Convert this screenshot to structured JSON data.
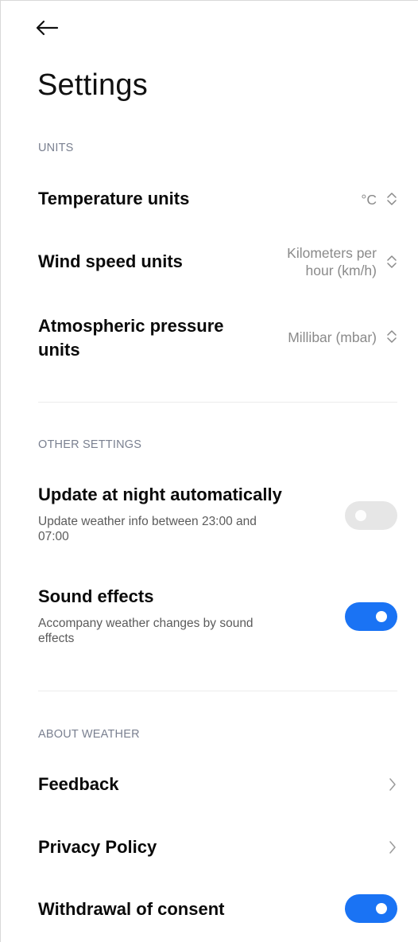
{
  "title": "Settings",
  "sections": {
    "units": {
      "header": "UNITS",
      "temperature": {
        "label": "Temperature units",
        "value": "°C"
      },
      "wind": {
        "label": "Wind speed units",
        "value_line1": "Kilometers per",
        "value_line2": "hour (km/h)"
      },
      "pressure": {
        "label_line1": "Atmospheric pressure",
        "label_line2": "units",
        "value": "Millibar (mbar)"
      }
    },
    "other": {
      "header": "OTHER SETTINGS",
      "night_update": {
        "label": "Update at night automatically",
        "sub_line1": "Update weather info between 23:00 and",
        "sub_line2": "07:00",
        "enabled": false
      },
      "sound": {
        "label": "Sound effects",
        "sub_line1": "Accompany weather changes by sound",
        "sub_line2": "effects",
        "enabled": true
      }
    },
    "about": {
      "header": "ABOUT WEATHER",
      "feedback": {
        "label": "Feedback"
      },
      "privacy": {
        "label": "Privacy Policy"
      },
      "withdrawal": {
        "label": "Withdrawal of consent",
        "enabled": true
      }
    }
  },
  "icons": {
    "back": "back-arrow-icon",
    "updown": "up-down-chevron-icon",
    "chevron": "chevron-right-icon"
  },
  "colors": {
    "accent": "#1a73f4",
    "toggle_off": "#e6e6e6",
    "section_header": "#7a8090",
    "value_text": "#8a8a8a"
  }
}
